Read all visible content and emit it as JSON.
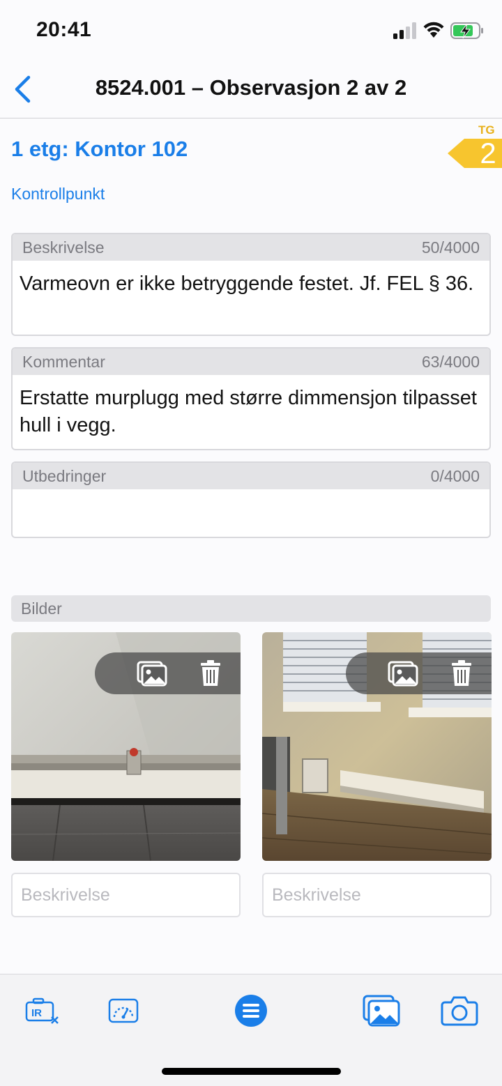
{
  "status_bar": {
    "time": "20:41"
  },
  "nav": {
    "title": "8524.001 – Observasjon 2 av 2"
  },
  "header": {
    "location": "1 etg: Kontor 102",
    "tg_label": "TG",
    "tg_value": "2",
    "kontrollpunkt_link": "Kontrollpunkt"
  },
  "fields": {
    "beskrivelse": {
      "label": "Beskrivelse",
      "count": "50/4000",
      "value": "Varmeovn er ikke betryggende festet. Jf. FEL § 36."
    },
    "kommentar": {
      "label": "Kommentar",
      "count": "63/4000",
      "value": "Erstatte murplugg med større dimmensjon tilpasset hull i vegg."
    },
    "utbedringer": {
      "label": "Utbedringer",
      "count": "0/4000",
      "value": ""
    }
  },
  "bilder": {
    "label": "Bilder",
    "photos": [
      {
        "description_placeholder": "Beskrivelse",
        "description_value": ""
      },
      {
        "description_placeholder": "Beskrivelse",
        "description_value": ""
      }
    ]
  },
  "tab_bar": {
    "icons": [
      "ir-camera-icon",
      "gauge-icon",
      "menu-icon",
      "photo-library-icon",
      "camera-icon"
    ]
  },
  "colors": {
    "accent": "#1a7ee8",
    "tg_badge": "#f7c52e",
    "field_header": "#e3e3e6"
  }
}
